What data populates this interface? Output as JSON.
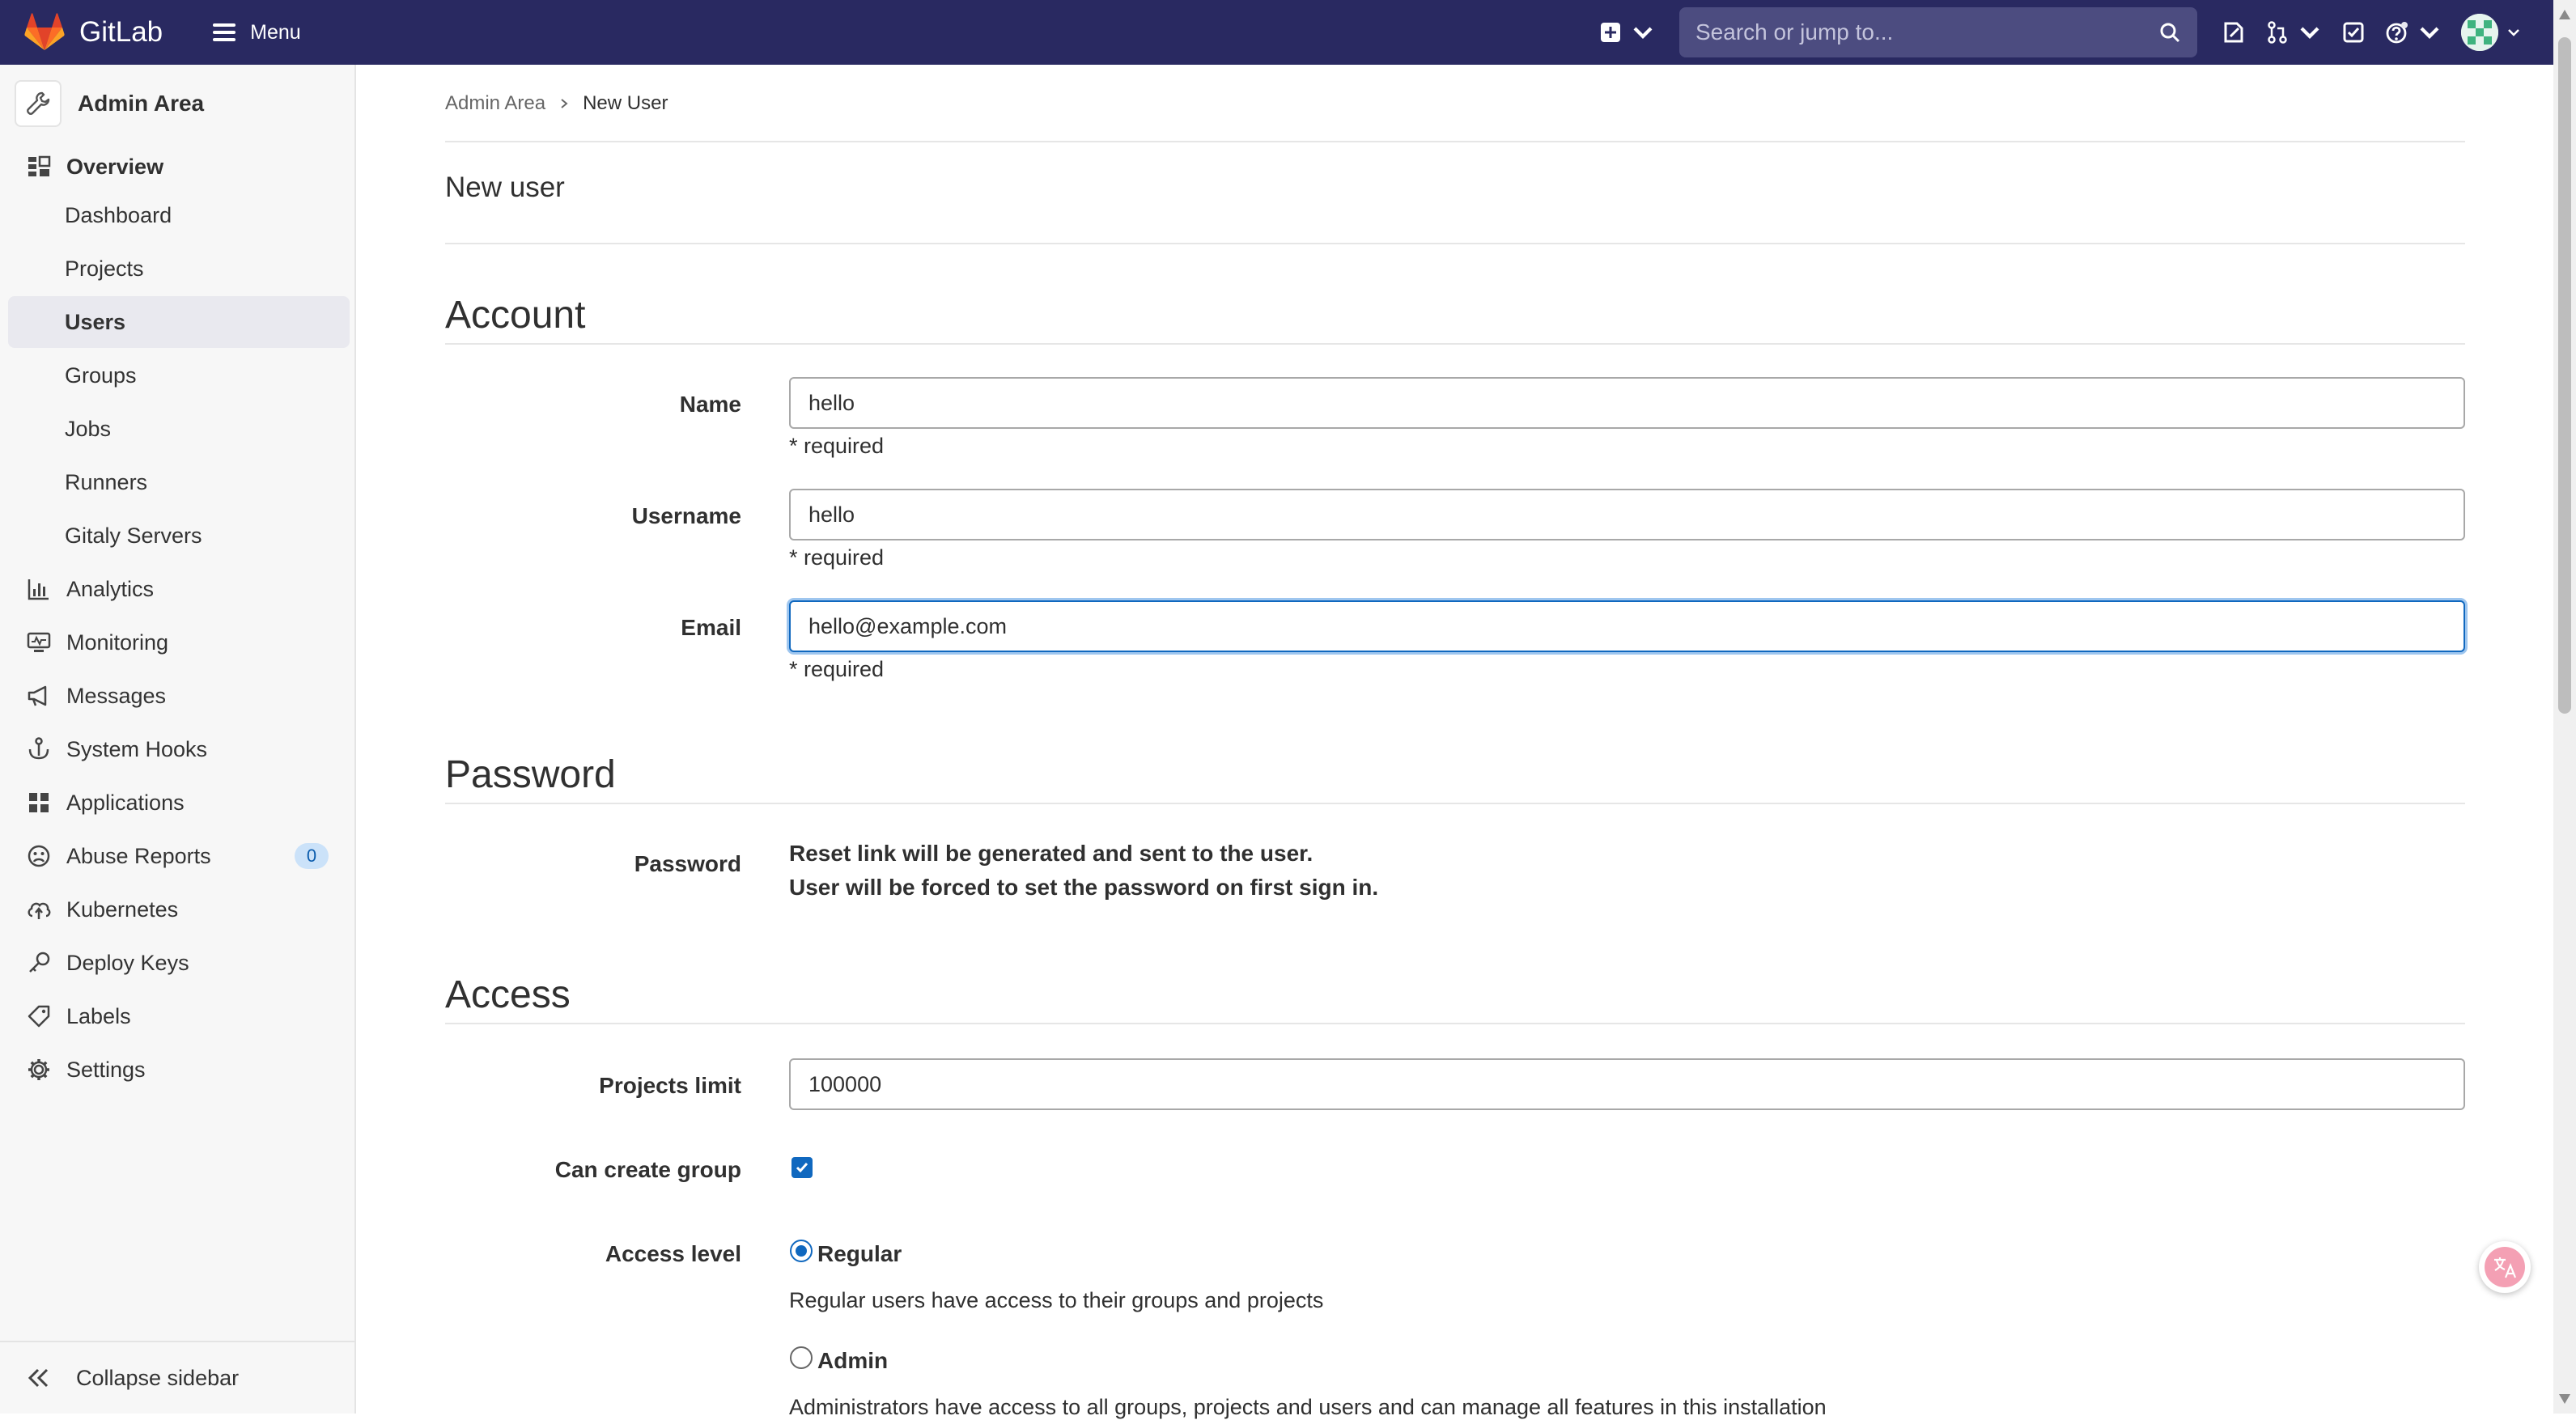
{
  "navbar": {
    "brand": "GitLab",
    "menu_label": "Menu",
    "search_placeholder": "Search or jump to..."
  },
  "sidebar": {
    "title": "Admin Area",
    "items": [
      {
        "label": "Overview",
        "icon": "overview-icon"
      },
      {
        "label": "Dashboard"
      },
      {
        "label": "Projects"
      },
      {
        "label": "Users"
      },
      {
        "label": "Groups"
      },
      {
        "label": "Jobs"
      },
      {
        "label": "Runners"
      },
      {
        "label": "Gitaly Servers"
      },
      {
        "label": "Analytics",
        "icon": "chart-icon"
      },
      {
        "label": "Monitoring",
        "icon": "monitor-icon"
      },
      {
        "label": "Messages",
        "icon": "megaphone-icon"
      },
      {
        "label": "System Hooks",
        "icon": "hook-icon"
      },
      {
        "label": "Applications",
        "icon": "applications-icon"
      },
      {
        "label": "Abuse Reports",
        "icon": "abuse-icon",
        "badge": "0"
      },
      {
        "label": "Kubernetes",
        "icon": "kubernetes-icon"
      },
      {
        "label": "Deploy Keys",
        "icon": "key-icon"
      },
      {
        "label": "Labels",
        "icon": "label-icon"
      },
      {
        "label": "Settings",
        "icon": "gear-icon"
      }
    ],
    "collapse_label": "Collapse sidebar"
  },
  "breadcrumb": {
    "parent": "Admin Area",
    "current": "New User"
  },
  "page_title": "New user",
  "account": {
    "heading": "Account",
    "name_label": "Name",
    "name_value": "hello",
    "username_label": "Username",
    "username_value": "hello",
    "email_label": "Email",
    "email_value": "hello@example.com",
    "required_text": "* required"
  },
  "password": {
    "heading": "Password",
    "label": "Password",
    "line1": "Reset link will be generated and sent to the user.",
    "line2": "User will be forced to set the password on first sign in."
  },
  "access": {
    "heading": "Access",
    "projects_limit_label": "Projects limit",
    "projects_limit_value": "100000",
    "can_create_group_label": "Can create group",
    "can_create_group_checked": true,
    "access_level_label": "Access level",
    "regular_label": "Regular",
    "regular_desc": "Regular users have access to their groups and projects",
    "admin_label": "Admin",
    "admin_desc": "Administrators have access to all groups, projects and users and can manage all features in this installation"
  },
  "colors": {
    "navbar_bg": "#292961",
    "accent": "#1068bf",
    "sidebar_bg": "#f7f7f7"
  }
}
